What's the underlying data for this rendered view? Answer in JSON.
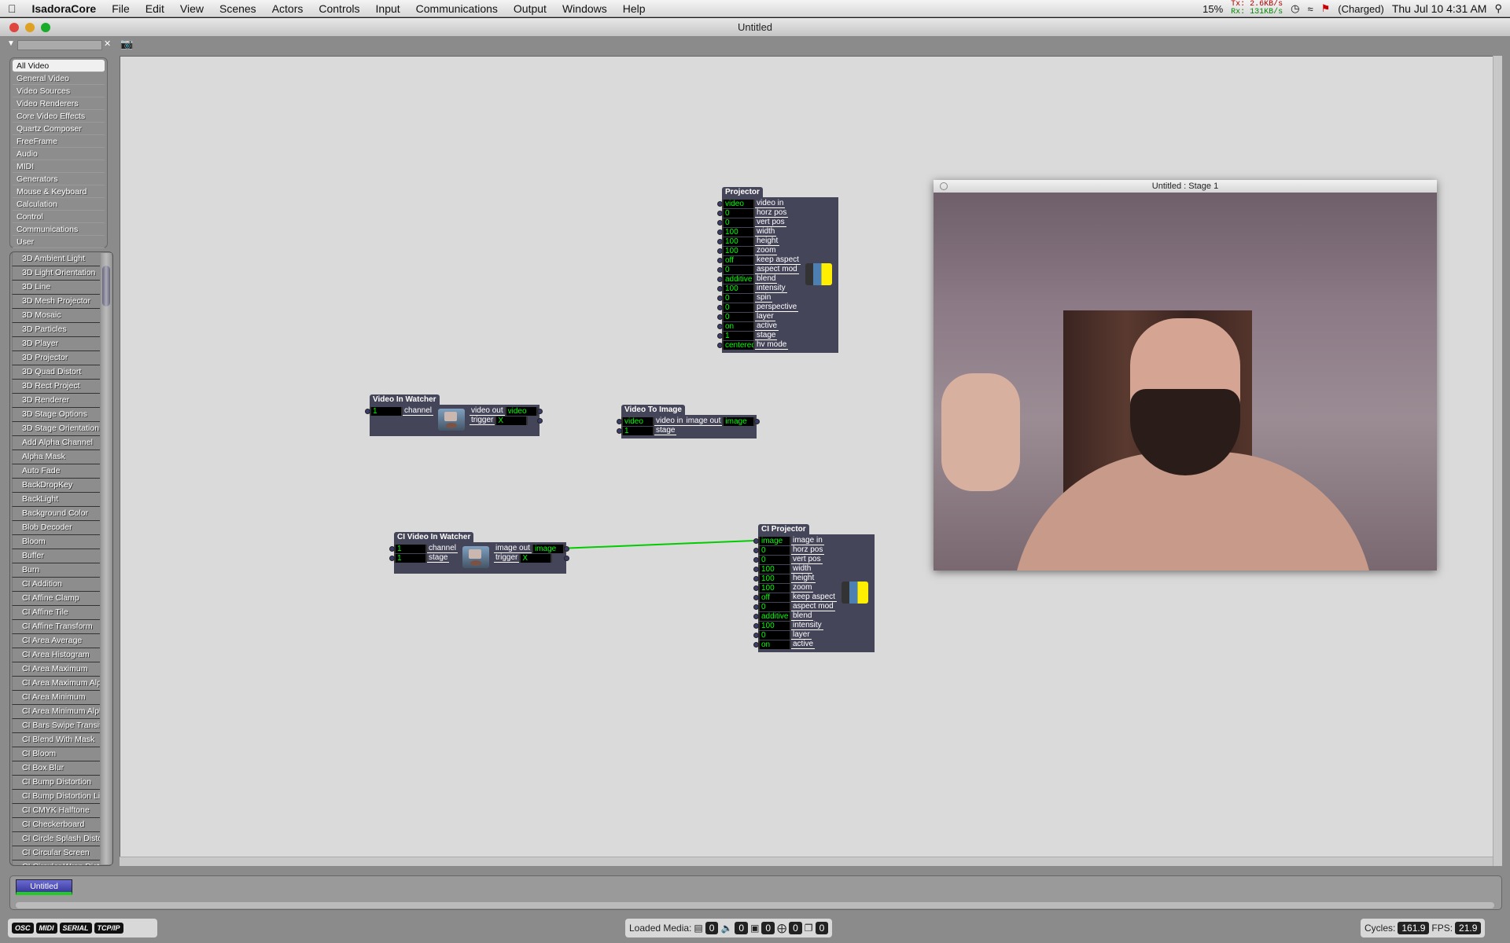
{
  "menubar": {
    "app": "IsadoraCore",
    "items": [
      "File",
      "Edit",
      "View",
      "Scenes",
      "Actors",
      "Controls",
      "Input",
      "Communications",
      "Output",
      "Windows",
      "Help"
    ],
    "battery_pct": "15%",
    "tx": "Tx:  2.6KB/s",
    "rx": "Rx:  131KB/s",
    "power": "(Charged)",
    "datetime": "Thu Jul 10  4:31 AM"
  },
  "window": {
    "title": "Untitled"
  },
  "categories": [
    "All Video",
    "General Video",
    "Video Sources",
    "Video Renderers",
    "Core Video Effects",
    "Quartz Composer",
    "FreeFrame",
    "Audio",
    "MIDI",
    "Generators",
    "Mouse & Keyboard",
    "Calculation",
    "Control",
    "Communications",
    "User"
  ],
  "actors": [
    "3D Ambient Light",
    "3D Light Orientation",
    "3D Line",
    "3D Mesh Projector",
    "3D Mosaic",
    "3D Particles",
    "3D Player",
    "3D Projector",
    "3D Quad Distort",
    "3D Rect Project",
    "3D Renderer",
    "3D Stage Options",
    "3D Stage Orientation",
    "Add Alpha Channel",
    "Alpha Mask",
    "Auto Fade",
    "BackDropKey",
    "BackLight",
    "Background Color",
    "Blob Decoder",
    "Bloom",
    "Buffer",
    "Burn",
    "CI Addition",
    "CI Affine Clamp",
    "CI Affine Tile",
    "CI Affine Transform",
    "CI Area Average",
    "CI Area Histogram",
    "CI Area Maximum",
    "CI Area Maximum Alpha",
    "CI Area Minimum",
    "CI Area Minimum Alpha",
    "CI Bars Swipe Transition",
    "CI Blend With Mask",
    "CI Bloom",
    "CI Box Blur",
    "CI Bump Distortion",
    "CI Bump Distortion Linear",
    "CI CMYK Halftone",
    "CI Checkerboard",
    "CI Circle Splash Distortion",
    "CI Circular Screen",
    "CI Circular Wrap Distortion"
  ],
  "nodes": {
    "projector": {
      "title": "Projector",
      "icon": "projector",
      "inputs": [
        [
          "video",
          "video in"
        ],
        [
          "0",
          "horz pos"
        ],
        [
          "0",
          "vert pos"
        ],
        [
          "100",
          "width"
        ],
        [
          "100",
          "height"
        ],
        [
          "100",
          "zoom"
        ],
        [
          "off",
          "keep aspect"
        ],
        [
          "0",
          "aspect mod"
        ],
        [
          "additive",
          "blend"
        ],
        [
          "100",
          "intensity"
        ],
        [
          "0",
          "spin"
        ],
        [
          "0",
          "perspective"
        ],
        [
          "0",
          "layer"
        ],
        [
          "on",
          "active"
        ],
        [
          "1",
          "stage"
        ],
        [
          "centered",
          "hv mode"
        ]
      ],
      "outputs": []
    },
    "video_in_watcher": {
      "title": "Video In Watcher",
      "icon": "camera",
      "inputs": [
        [
          "1",
          "channel"
        ]
      ],
      "outputs": [
        [
          "video out",
          "video"
        ],
        [
          "trigger",
          "X"
        ]
      ]
    },
    "video_to_image": {
      "title": "Video To Image",
      "icon": "",
      "inputs": [
        [
          "video",
          "video in"
        ],
        [
          "1",
          "stage"
        ]
      ],
      "outputs": [
        [
          "image out",
          "image"
        ]
      ]
    },
    "ci_video_in_watcher": {
      "title": "CI Video In Watcher",
      "icon": "camera",
      "inputs": [
        [
          "1",
          "channel"
        ],
        [
          "1",
          "stage"
        ]
      ],
      "outputs": [
        [
          "image out",
          "image"
        ],
        [
          "trigger",
          "X"
        ]
      ]
    },
    "ci_projector": {
      "title": "CI Projector",
      "icon": "projector",
      "inputs": [
        [
          "image",
          "image in"
        ],
        [
          "0",
          "horz pos"
        ],
        [
          "0",
          "vert pos"
        ],
        [
          "100",
          "width"
        ],
        [
          "100",
          "height"
        ],
        [
          "100",
          "zoom"
        ],
        [
          "off",
          "keep aspect"
        ],
        [
          "0",
          "aspect mod"
        ],
        [
          "additive",
          "blend"
        ],
        [
          "100",
          "intensity"
        ],
        [
          "0",
          "layer"
        ],
        [
          "on",
          "active"
        ]
      ],
      "outputs": []
    }
  },
  "wire_color": "#00cc00",
  "stage_window": {
    "title": "Untitled : Stage 1"
  },
  "scenes": [
    "Untitled"
  ],
  "status": {
    "protocols": [
      "OSC",
      "MIDI",
      "SERIAL",
      "TCP/IP"
    ],
    "loaded_media_label": "Loaded Media:",
    "media_counts": [
      "0",
      "0",
      "0",
      "0",
      "0"
    ],
    "cycles_label": "Cycles:",
    "cycles": "161.9",
    "fps_label": "FPS:",
    "fps": "21.9"
  }
}
